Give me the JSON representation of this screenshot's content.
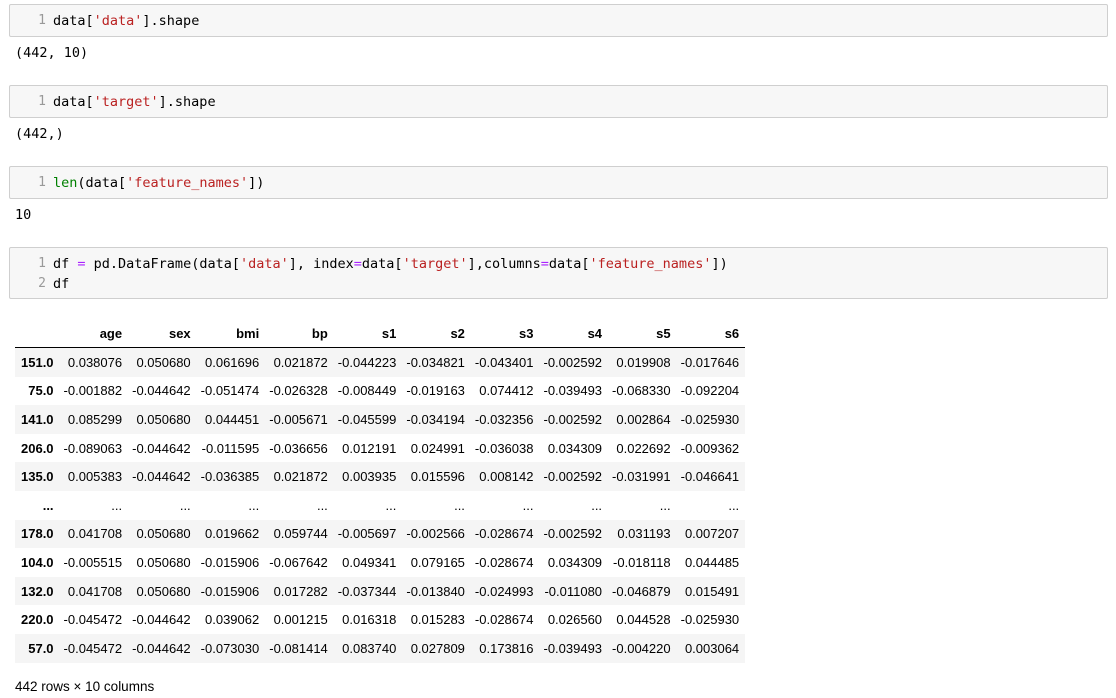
{
  "cells": [
    {
      "lines": [
        {
          "num": "1",
          "tokens": [
            {
              "t": "data[",
              "c": ""
            },
            {
              "t": "'data'",
              "c": "str"
            },
            {
              "t": "].shape",
              "c": ""
            }
          ]
        }
      ],
      "output": "(442, 10)"
    },
    {
      "lines": [
        {
          "num": "1",
          "tokens": [
            {
              "t": "data[",
              "c": ""
            },
            {
              "t": "'target'",
              "c": "str"
            },
            {
              "t": "].shape",
              "c": ""
            }
          ]
        }
      ],
      "output": "(442,)"
    },
    {
      "lines": [
        {
          "num": "1",
          "tokens": [
            {
              "t": "len",
              "c": "builtin"
            },
            {
              "t": "(data[",
              "c": ""
            },
            {
              "t": "'feature_names'",
              "c": "str"
            },
            {
              "t": "])",
              "c": ""
            }
          ]
        }
      ],
      "output": "10"
    },
    {
      "lines": [
        {
          "num": "1",
          "tokens": [
            {
              "t": "df ",
              "c": ""
            },
            {
              "t": "=",
              "c": "op"
            },
            {
              "t": " pd.DataFrame(data[",
              "c": ""
            },
            {
              "t": "'data'",
              "c": "str"
            },
            {
              "t": "], index",
              "c": ""
            },
            {
              "t": "=",
              "c": "op"
            },
            {
              "t": "data[",
              "c": ""
            },
            {
              "t": "'target'",
              "c": "str"
            },
            {
              "t": "],columns",
              "c": ""
            },
            {
              "t": "=",
              "c": "op"
            },
            {
              "t": "data[",
              "c": ""
            },
            {
              "t": "'feature_names'",
              "c": "str"
            },
            {
              "t": "])",
              "c": ""
            }
          ]
        },
        {
          "num": "2",
          "tokens": [
            {
              "t": "df",
              "c": ""
            }
          ]
        }
      ]
    }
  ],
  "dataframe": {
    "columns": [
      "age",
      "sex",
      "bmi",
      "bp",
      "s1",
      "s2",
      "s3",
      "s4",
      "s5",
      "s6"
    ],
    "rows": [
      {
        "index": "151.0",
        "values": [
          "0.038076",
          "0.050680",
          "0.061696",
          "0.021872",
          "-0.044223",
          "-0.034821",
          "-0.043401",
          "-0.002592",
          "0.019908",
          "-0.017646"
        ]
      },
      {
        "index": "75.0",
        "values": [
          "-0.001882",
          "-0.044642",
          "-0.051474",
          "-0.026328",
          "-0.008449",
          "-0.019163",
          "0.074412",
          "-0.039493",
          "-0.068330",
          "-0.092204"
        ]
      },
      {
        "index": "141.0",
        "values": [
          "0.085299",
          "0.050680",
          "0.044451",
          "-0.005671",
          "-0.045599",
          "-0.034194",
          "-0.032356",
          "-0.002592",
          "0.002864",
          "-0.025930"
        ]
      },
      {
        "index": "206.0",
        "values": [
          "-0.089063",
          "-0.044642",
          "-0.011595",
          "-0.036656",
          "0.012191",
          "0.024991",
          "-0.036038",
          "0.034309",
          "0.022692",
          "-0.009362"
        ]
      },
      {
        "index": "135.0",
        "values": [
          "0.005383",
          "-0.044642",
          "-0.036385",
          "0.021872",
          "0.003935",
          "0.015596",
          "0.008142",
          "-0.002592",
          "-0.031991",
          "-0.046641"
        ]
      },
      {
        "index": "...",
        "values": [
          "...",
          "...",
          "...",
          "...",
          "...",
          "...",
          "...",
          "...",
          "...",
          "..."
        ]
      },
      {
        "index": "178.0",
        "values": [
          "0.041708",
          "0.050680",
          "0.019662",
          "0.059744",
          "-0.005697",
          "-0.002566",
          "-0.028674",
          "-0.002592",
          "0.031193",
          "0.007207"
        ]
      },
      {
        "index": "104.0",
        "values": [
          "-0.005515",
          "0.050680",
          "-0.015906",
          "-0.067642",
          "0.049341",
          "0.079165",
          "-0.028674",
          "0.034309",
          "-0.018118",
          "0.044485"
        ]
      },
      {
        "index": "132.0",
        "values": [
          "0.041708",
          "0.050680",
          "-0.015906",
          "0.017282",
          "-0.037344",
          "-0.013840",
          "-0.024993",
          "-0.011080",
          "-0.046879",
          "0.015491"
        ]
      },
      {
        "index": "220.0",
        "values": [
          "-0.045472",
          "-0.044642",
          "0.039062",
          "0.001215",
          "0.016318",
          "0.015283",
          "-0.028674",
          "0.026560",
          "0.044528",
          "-0.025930"
        ]
      },
      {
        "index": "57.0",
        "values": [
          "-0.045472",
          "-0.044642",
          "-0.073030",
          "-0.081414",
          "0.083740",
          "0.027809",
          "0.173816",
          "-0.039493",
          "-0.004220",
          "0.003064"
        ]
      }
    ],
    "dimensions": "442 rows × 10 columns"
  }
}
